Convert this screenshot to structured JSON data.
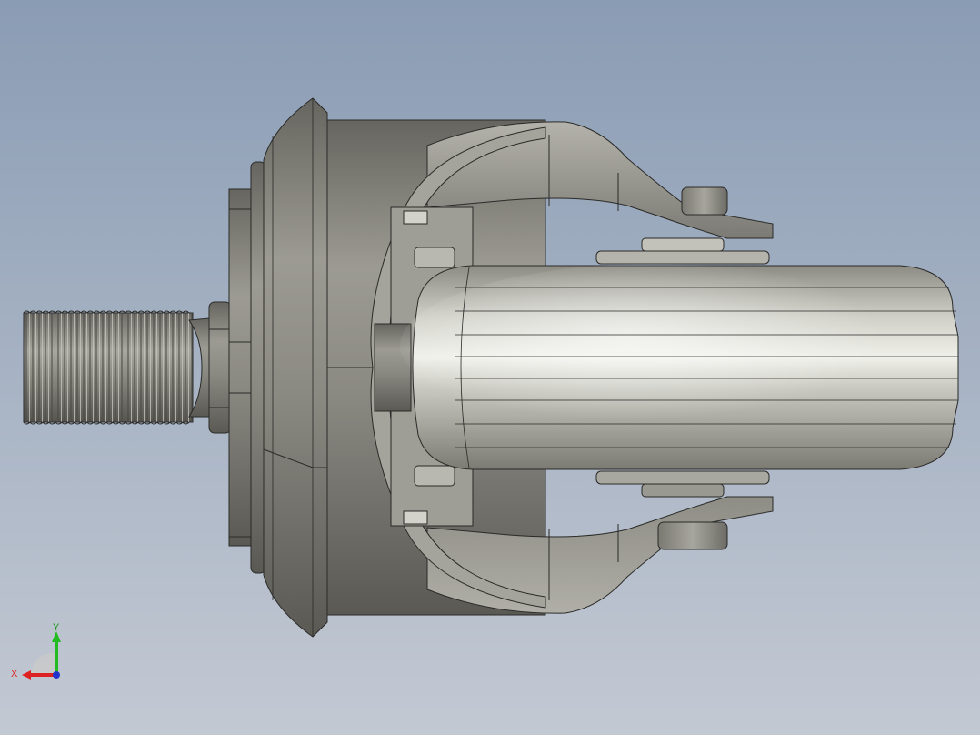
{
  "viewport": {
    "background_top": "#8a9cb4",
    "background_bottom": "#c3c9d3"
  },
  "model": {
    "metal_color": "#8d8c85",
    "tire_color": "#cfcfc6"
  },
  "triad": {
    "x_label": "X",
    "y_label": "Y",
    "x_color": "#dd2222",
    "y_color": "#22bb22",
    "z_color": "#2233cc"
  }
}
